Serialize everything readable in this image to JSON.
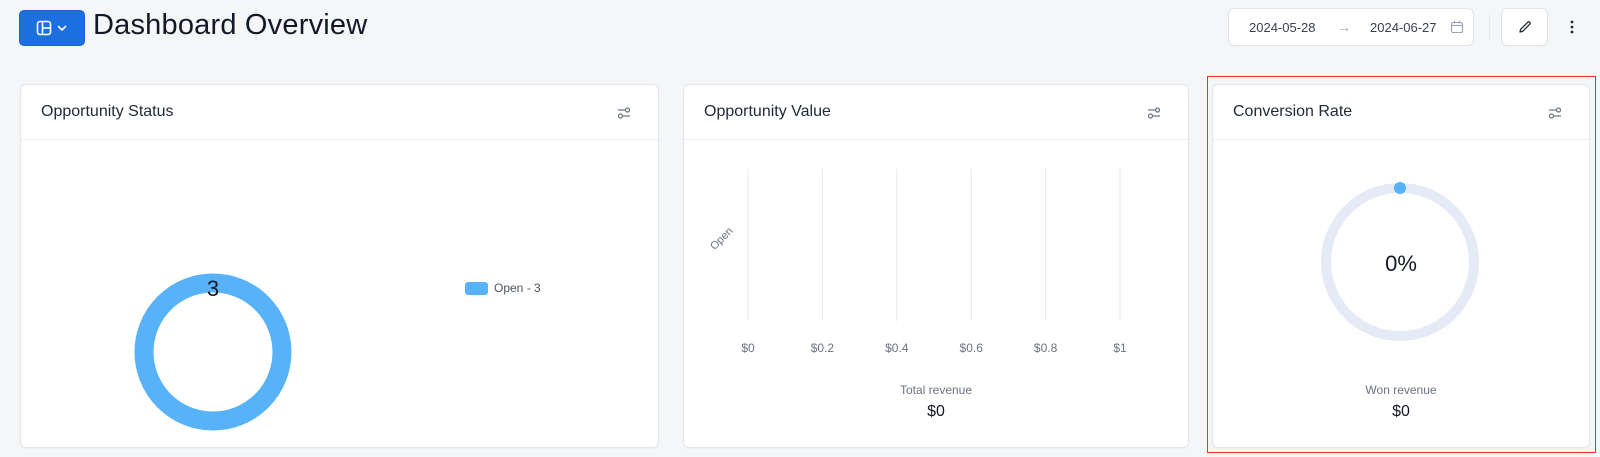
{
  "header": {
    "title": "Dashboard Overview",
    "date_start": "2024-05-28",
    "date_end": "2024-06-27",
    "date_arrow": "→"
  },
  "cards": {
    "status": {
      "title": "Opportunity Status",
      "center_value": "3",
      "legend_label": "Open - 3",
      "color": "#57b2f8"
    },
    "value": {
      "title": "Opportunity Value",
      "caption_label": "Total revenue",
      "caption_value": "$0"
    },
    "conversion": {
      "title": "Conversion Rate",
      "center_value": "0%",
      "caption_label": "Won revenue",
      "caption_value": "$0",
      "progress": 0
    }
  },
  "chart_data": [
    {
      "type": "pie",
      "categories": [
        "Open"
      ],
      "values": [
        3
      ],
      "legend": [
        "Open - 3"
      ],
      "center_label": "3"
    },
    {
      "type": "bar",
      "orientation": "horizontal",
      "categories": [
        "Open"
      ],
      "values": [
        0
      ],
      "xticks": [
        "$0",
        "$0.2",
        "$0.4",
        "$0.6",
        "$0.8",
        "$1"
      ],
      "xlim": [
        0,
        1
      ],
      "grid": true
    }
  ],
  "colors": {
    "accent": "#1d6fe0",
    "series": "#57b2f8",
    "track": "#e4ebf6",
    "highlight": "#e0322f"
  }
}
